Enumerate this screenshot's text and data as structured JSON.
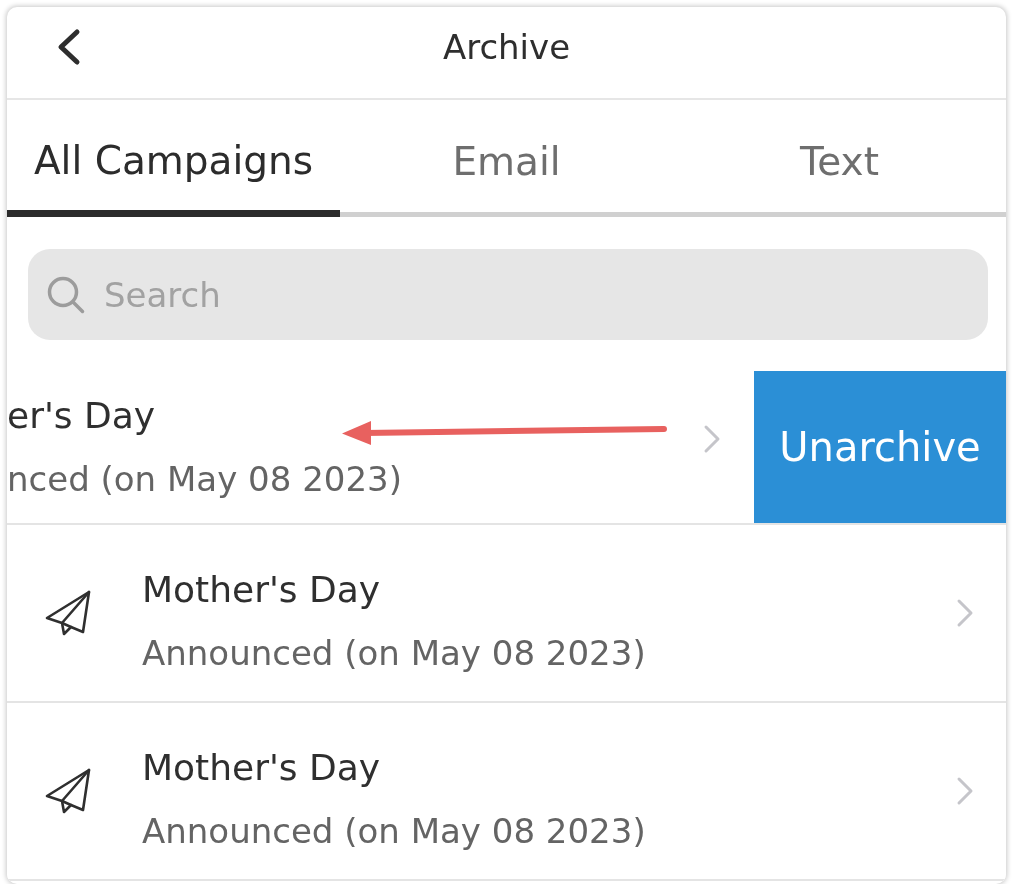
{
  "header": {
    "title": "Archive"
  },
  "tabs": [
    {
      "label": "All Campaigns",
      "selected": true
    },
    {
      "label": "Email",
      "selected": false
    },
    {
      "label": "Text",
      "selected": false
    }
  ],
  "search": {
    "placeholder": "Search"
  },
  "campaigns": [
    {
      "title": "er's Day",
      "subtitle": "nced (on May 08 2023)",
      "swiped": true,
      "action": "Unarchive"
    },
    {
      "title": "Mother's Day",
      "subtitle": "Announced (on May 08 2023)",
      "swiped": false
    },
    {
      "title": "Mother's Day",
      "subtitle": "Announced (on May 08 2023)",
      "swiped": false
    }
  ]
}
